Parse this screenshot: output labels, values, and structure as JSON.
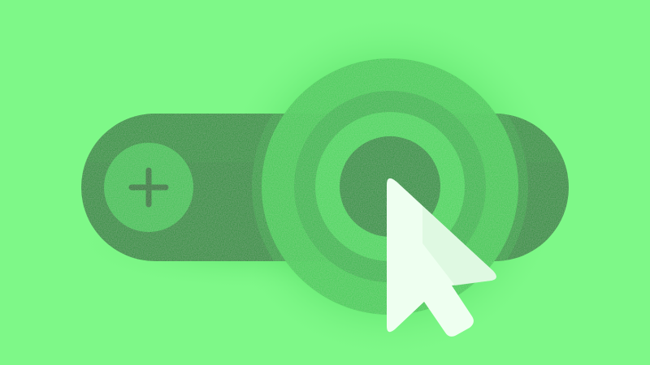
{
  "scene": {
    "description_icon": "click-target-illustration"
  },
  "toggle": {
    "icon": "plus-icon",
    "state": "off"
  },
  "cursor": {
    "icon": "mouse-pointer-icon"
  },
  "colors": {
    "background": "#7ef888",
    "pill_dark": "#0d8a2a",
    "pill_mid": "#149c33",
    "knob": "#2fbf4a",
    "plus_stroke": "#0b7424",
    "ring_outer_halo": "#63e671",
    "ring_1": "#3fd255",
    "ring_2": "#2cc445",
    "ring_3": "#1aa83a",
    "center_dot": "#0f8e2d",
    "cursor_fill": "#eefff0",
    "shadow": "#5fd868"
  }
}
